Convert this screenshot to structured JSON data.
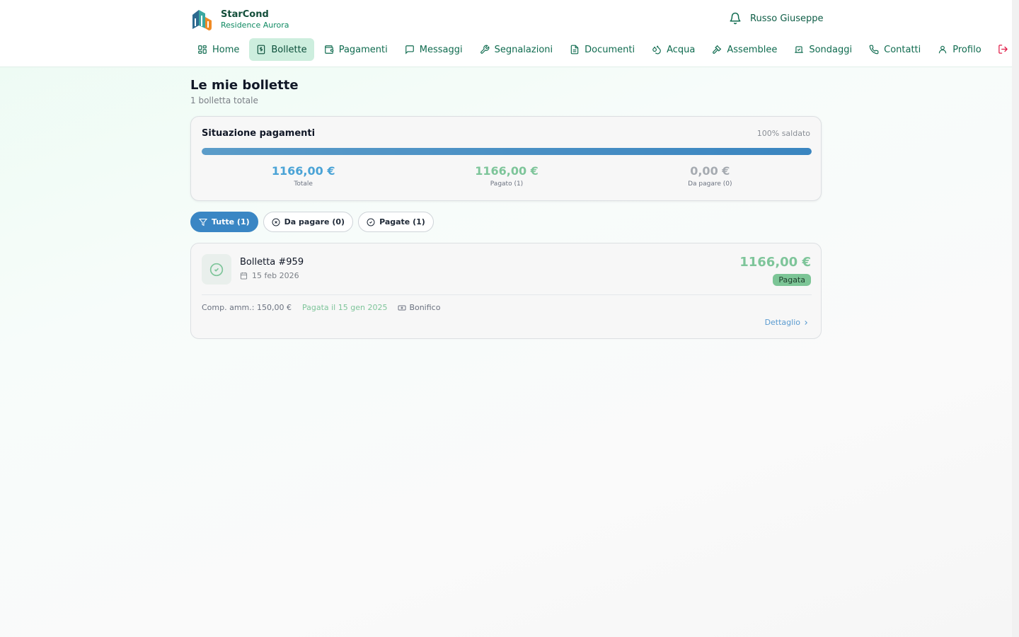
{
  "brand": {
    "name": "StarCond",
    "subtitle": "Residence Aurora"
  },
  "user": {
    "name": "Russo Giuseppe",
    "icon": "bell-icon"
  },
  "nav": {
    "items": [
      {
        "label": "Home",
        "icon": "grid-icon"
      },
      {
        "label": "Bollette",
        "icon": "receipt-icon",
        "active": true
      },
      {
        "label": "Pagamenti",
        "icon": "wallet-icon"
      },
      {
        "label": "Messaggi",
        "icon": "chat-icon"
      },
      {
        "label": "Segnalazioni",
        "icon": "wrench-icon"
      },
      {
        "label": "Documenti",
        "icon": "document-icon"
      },
      {
        "label": "Acqua",
        "icon": "droplets-icon"
      },
      {
        "label": "Assemblee",
        "icon": "gavel-icon"
      },
      {
        "label": "Sondaggi",
        "icon": "vote-icon"
      },
      {
        "label": "Contatti",
        "icon": "phone-icon"
      },
      {
        "label": "Profilo",
        "icon": "user-icon"
      }
    ],
    "logout_icon": "logout-icon"
  },
  "page": {
    "title": "Le mie bollette",
    "subtitle": "1 bolletta totale"
  },
  "summary": {
    "title": "Situazione pagamenti",
    "percent_label": "100% saldato",
    "progress": 1.0,
    "stats": [
      {
        "value": "1166,00 €",
        "label": "Totale",
        "color": "#4aa3d6"
      },
      {
        "value": "1166,00 €",
        "label": "Pagato (1)",
        "color": "#7ec59a"
      },
      {
        "value": "0,00 €",
        "label": "Da pagare (0)",
        "color": "#a6abb1"
      }
    ]
  },
  "filters": [
    {
      "label": "Tutte (1)",
      "icon": "filter-icon",
      "active": true
    },
    {
      "label": "Da pagare (0)",
      "icon": "x-circle-icon",
      "active": false
    },
    {
      "label": "Pagate (1)",
      "icon": "check-circle-icon",
      "active": false
    }
  ],
  "bill": {
    "title": "Bolletta #959",
    "date": "15 feb 2026",
    "amount": "1166,00 €",
    "status": "Pagata",
    "comp": "Comp. amm.: 150,00 €",
    "paid_on": "Pagata il 15 gen 2025",
    "method": "Bonifico",
    "detail_label": "Dettaglio"
  },
  "colors": {
    "accent": "#3a86c4",
    "brand_green": "#0f6b4f",
    "paid": "#7ec59a"
  }
}
